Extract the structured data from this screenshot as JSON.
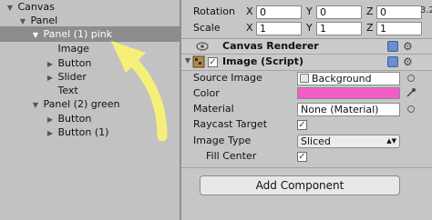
{
  "hierarchy": {
    "items": [
      {
        "label": "Canvas",
        "arrow": "▼"
      },
      {
        "label": "Panel",
        "arrow": "▼"
      },
      {
        "label": "Panel (1) pink",
        "arrow": "▼"
      },
      {
        "label": "Image",
        "arrow": ""
      },
      {
        "label": "Button",
        "arrow": "▶"
      },
      {
        "label": "Slider",
        "arrow": "▶"
      },
      {
        "label": "Text",
        "arrow": ""
      },
      {
        "label": "Panel (2) green",
        "arrow": "▼"
      },
      {
        "label": "Button",
        "arrow": "▶"
      },
      {
        "label": "Button (1)",
        "arrow": "▶"
      }
    ]
  },
  "annotation": {
    "arrow_color": "#f6ef7a"
  },
  "transform": {
    "rotation_label": "Rotation",
    "scale_label": "Scale",
    "rotation": {
      "x_label": "X",
      "x": "0",
      "y_label": "Y",
      "y": "0",
      "z_label": "Z",
      "z": "0"
    },
    "scale": {
      "x_label": "X",
      "x": "1",
      "y_label": "Y",
      "y": "1",
      "z_label": "Z",
      "z": "1"
    },
    "overflow_value": "3.2"
  },
  "canvas_renderer": {
    "title": "Canvas Renderer"
  },
  "image_script": {
    "title": "Image (Script)",
    "source_image_label": "Source Image",
    "source_image_value": "Background",
    "color_label": "Color",
    "color_value": "#f25dc8",
    "material_label": "Material",
    "material_value": "None (Material)",
    "raycast_label": "Raycast Target",
    "image_type_label": "Image Type",
    "image_type_value": "Sliced",
    "fill_center_label": "Fill Center"
  },
  "add_component_label": "Add Component"
}
